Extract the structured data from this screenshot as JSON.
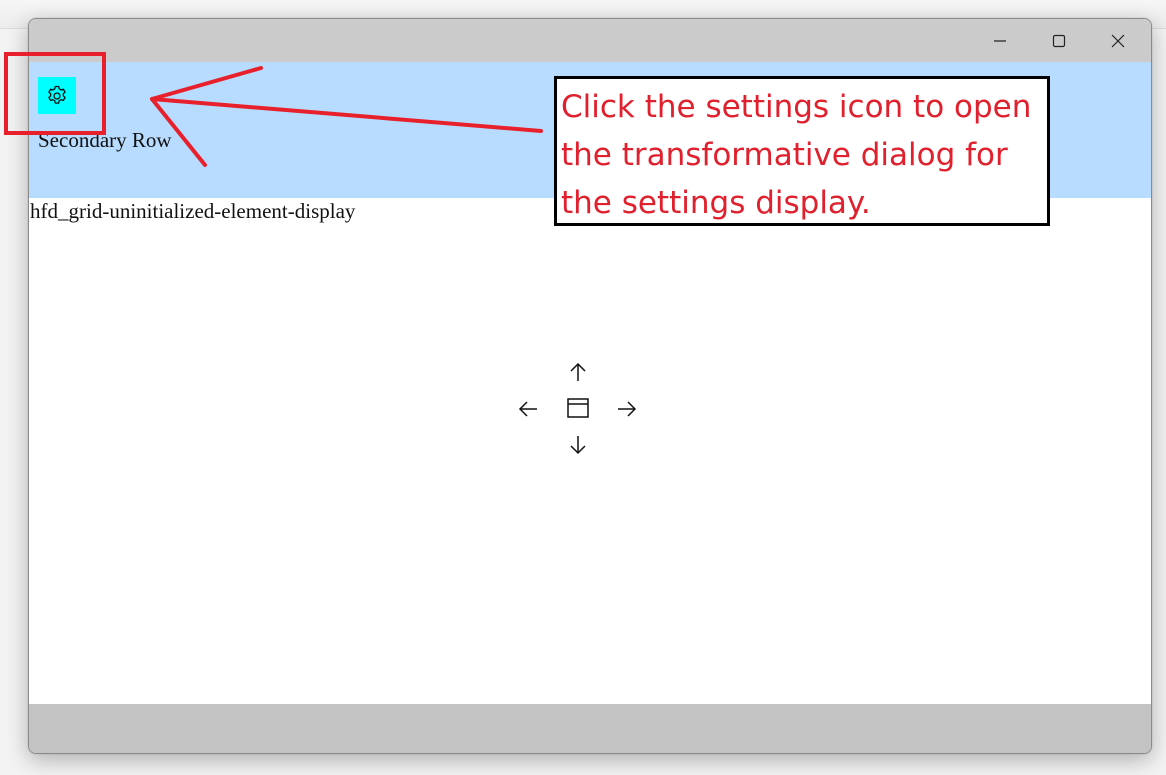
{
  "window": {
    "minimize_icon": "minimize-icon",
    "maximize_icon": "maximize-icon",
    "close_icon": "close-icon"
  },
  "toolbar": {
    "settings_icon": "gear-icon",
    "secondary_row_label": "Secondary Row"
  },
  "content": {
    "uninitialized_text": "hfd_grid-uninitialized-element-display"
  },
  "nav_cluster": {
    "up_icon": "arrow-up-icon",
    "down_icon": "arrow-down-icon",
    "left_icon": "arrow-left-icon",
    "right_icon": "arrow-right-icon",
    "center_icon": "window-icon"
  },
  "annotation": {
    "text": "Click the settings icon to open the transformative dialog for the settings display.",
    "text_color": "#e0202c",
    "highlight_color": "#e8202c"
  },
  "colors": {
    "titlebar": "#cbcbcb",
    "toolbar_row": "#b8dcff",
    "settings_button": "#00ffff",
    "bottom_bar": "#c3c3c3"
  }
}
